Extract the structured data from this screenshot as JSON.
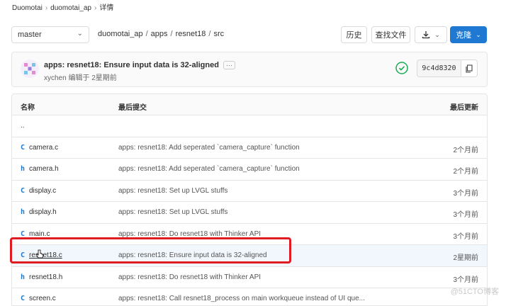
{
  "breadcrumb": {
    "items": [
      "Duomotai",
      "duomotai_ap",
      "详情"
    ],
    "separator": "›"
  },
  "branch": {
    "value": "master"
  },
  "path": {
    "items": [
      "duomotai_ap",
      "apps",
      "resnet18",
      "src"
    ],
    "separator": "/"
  },
  "toolbar": {
    "history": "历史",
    "find_file": "查找文件",
    "clone": "克隆"
  },
  "commit": {
    "title": "apps: resnet18: Ensure input data is 32-aligned",
    "more": "···",
    "author_line": "xychen 编辑于 2星期前",
    "sha": "9c4d8320"
  },
  "table": {
    "headers": {
      "name": "名称",
      "last_commit": "最后提交",
      "last_update": "最后更新"
    },
    "parent": "..",
    "rows": [
      {
        "icon": "C",
        "name": "camera.c",
        "message": "apps: resnet18: Add seperated `camera_capture` function",
        "updated": "2个月前"
      },
      {
        "icon": "h",
        "name": "camera.h",
        "message": "apps: resnet18: Add seperated `camera_capture` function",
        "updated": "2个月前"
      },
      {
        "icon": "C",
        "name": "display.c",
        "message": "apps: resnet18: Set up LVGL stuffs",
        "updated": "3个月前"
      },
      {
        "icon": "h",
        "name": "display.h",
        "message": "apps: resnet18: Set up LVGL stuffs",
        "updated": "3个月前"
      },
      {
        "icon": "C",
        "name": "main.c",
        "message": "apps: resnet18: Do resnet18 with Thinker API",
        "updated": "3个月前"
      },
      {
        "icon": "C",
        "name": "resnet18.c",
        "message": "apps: resnet18: Ensure input data is 32-aligned",
        "updated": "2星期前"
      },
      {
        "icon": "h",
        "name": "resnet18.h",
        "message": "apps: resnet18: Do resnet18 with Thinker API",
        "updated": "3个月前"
      },
      {
        "icon": "C",
        "name": "screen.c",
        "message": "apps: resnet18: Call resnet18_process on main workqueue instead of UI que...",
        "updated": ""
      }
    ]
  },
  "watermark": "@51CTO博客",
  "colors": {
    "accent": "#1f78d1",
    "success": "#1aaa55",
    "highlight": "#e11b22"
  }
}
